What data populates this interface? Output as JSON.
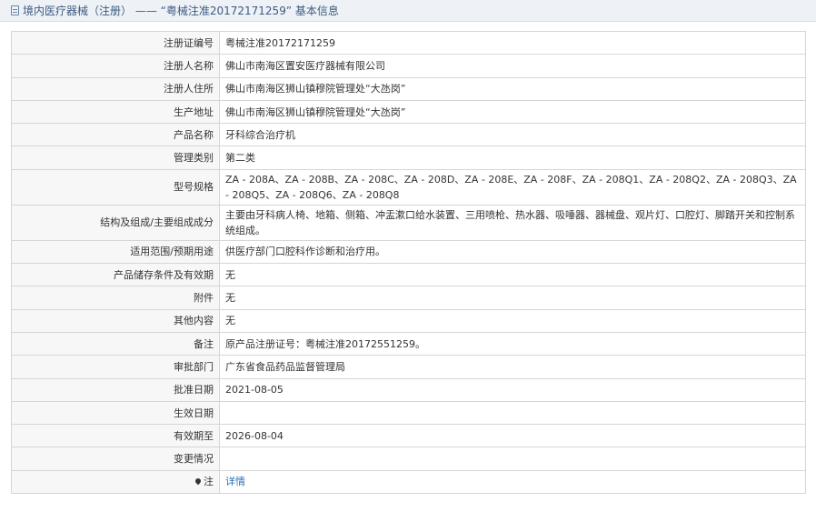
{
  "header": {
    "title": "境内医疗器械（注册） —— “粤械注准20172171259” 基本信息"
  },
  "rows": [
    {
      "label": "注册证编号",
      "value": "粤械注准20172171259"
    },
    {
      "label": "注册人名称",
      "value": "佛山市南海区置安医疗器械有限公司"
    },
    {
      "label": "注册人住所",
      "value": "佛山市南海区狮山镇穆院管理处“大氹岗”"
    },
    {
      "label": "生产地址",
      "value": "佛山市南海区狮山镇穆院管理处“大氹岗”"
    },
    {
      "label": "产品名称",
      "value": "牙科综合治疗机"
    },
    {
      "label": "管理类别",
      "value": "第二类"
    },
    {
      "label": "型号规格",
      "value": "ZA - 208A、ZA - 208B、ZA - 208C、ZA - 208D、ZA - 208E、ZA - 208F、ZA - 208Q1、ZA - 208Q2、ZA - 208Q3、ZA - 208Q5、ZA - 208Q6、ZA - 208Q8"
    },
    {
      "label": "结构及组成/主要组成成分",
      "value": "主要由牙科病人椅、地箱、侧箱、冲盂漱口给水装置、三用喷枪、热水器、吸唾器、器械盘、观片灯、口腔灯、脚踏开关和控制系统组成。"
    },
    {
      "label": "适用范围/预期用途",
      "value": "供医疗部门口腔科作诊断和治疗用。"
    },
    {
      "label": "产品储存条件及有效期",
      "value": "无"
    },
    {
      "label": "附件",
      "value": "无"
    },
    {
      "label": "其他内容",
      "value": "无"
    },
    {
      "label": "备注",
      "value": "原产品注册证号：粤械注准20172551259。"
    },
    {
      "label": "审批部门",
      "value": "广东省食品药品监督管理局"
    },
    {
      "label": "批准日期",
      "value": "2021-08-05"
    },
    {
      "label": "生效日期",
      "value": ""
    },
    {
      "label": "有效期至",
      "value": "2026-08-04"
    },
    {
      "label": "变更情况",
      "value": ""
    },
    {
      "label": "注",
      "value": "详情"
    }
  ],
  "icons": {
    "header": "document-icon",
    "note": "location-pin-icon"
  }
}
